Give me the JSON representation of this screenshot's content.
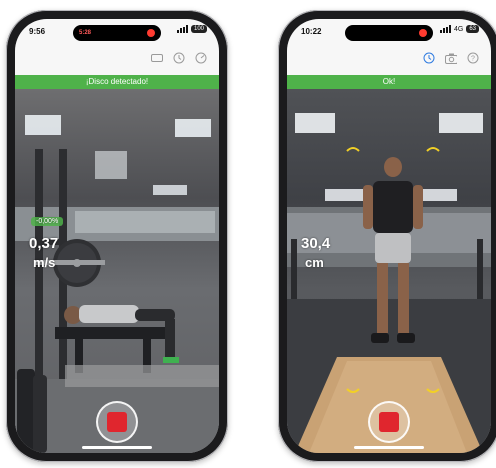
{
  "left_phone": {
    "time": "9:56",
    "island_pill": "5:28",
    "battery": "100",
    "banner": "¡Disco detectado!",
    "percent": "-0,00%",
    "velocity": "0,37",
    "velocity_unit": "m/s",
    "banner_color": "#4fb24a"
  },
  "right_phone": {
    "time": "10:22",
    "network": "4G",
    "battery": "63",
    "banner": "Ok!",
    "distance": "30,4",
    "distance_unit": "cm",
    "banner_color": "#4fb24a"
  },
  "icons": [
    "battery-outline-icon",
    "history-icon",
    "speed-icon",
    "camera-icon",
    "help-icon",
    "stop-icon"
  ],
  "colors": {
    "accent_green": "#4fb24a",
    "stop_red": "#e0262e",
    "record_red": "#ff3b30"
  }
}
